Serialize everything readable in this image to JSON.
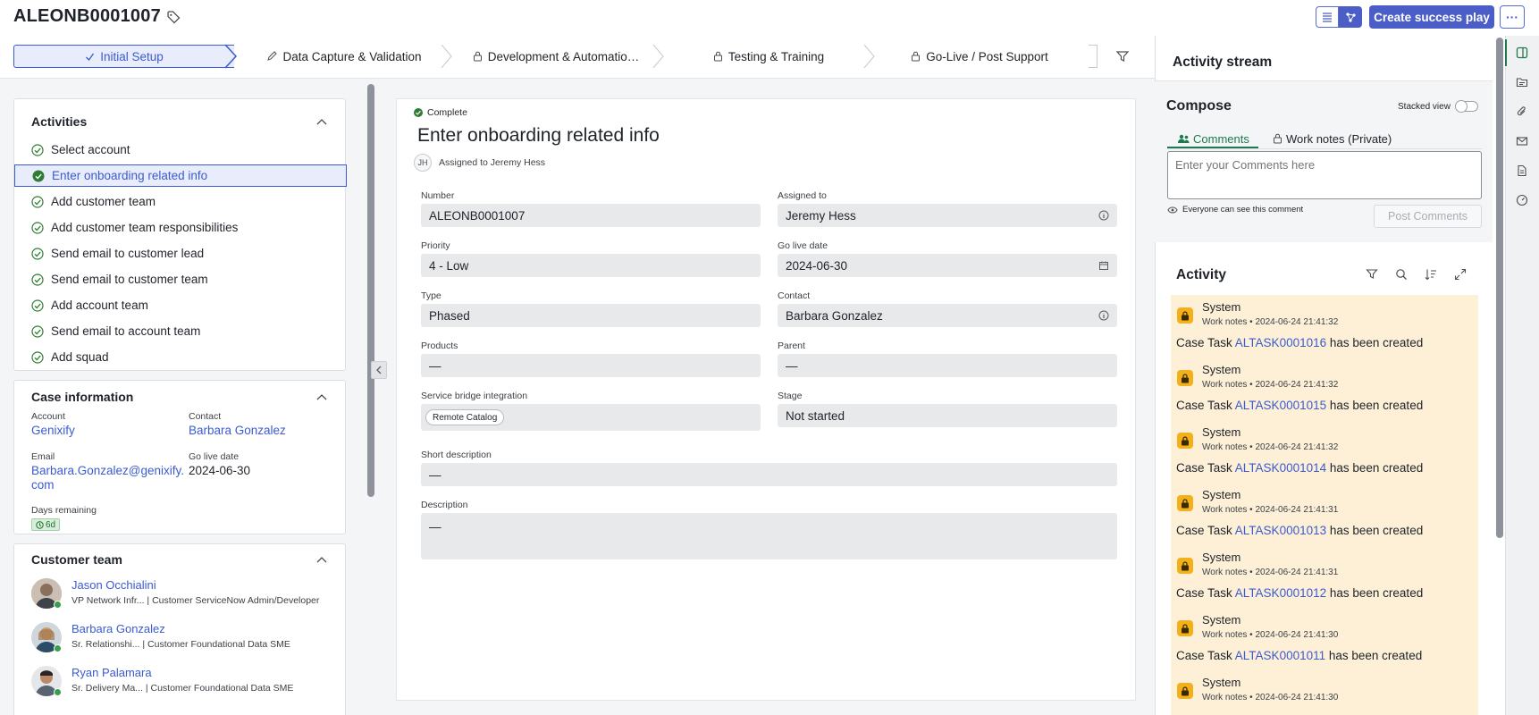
{
  "header": {
    "record_number": "ALEONB0001007",
    "create_button": "Create success play",
    "more_button": "···"
  },
  "stages": [
    {
      "label": "Initial Setup",
      "state": "complete"
    },
    {
      "label": "Data Capture & Validation",
      "state": "editable"
    },
    {
      "label": "Development & Automatio…",
      "state": "locked"
    },
    {
      "label": "Testing & Training",
      "state": "locked"
    },
    {
      "label": "Go-Live / Post Support",
      "state": "locked"
    }
  ],
  "activities": {
    "title": "Activities",
    "items": [
      "Select account",
      "Enter onboarding related info",
      "Add customer team",
      "Add customer team responsibilities",
      "Send email to customer lead",
      "Send email to customer team",
      "Add account team",
      "Send email to account team",
      "Add squad"
    ],
    "selected_index": 1
  },
  "case_info": {
    "title": "Case information",
    "account_label": "Account",
    "account_value": "Genixify",
    "contact_label": "Contact",
    "contact_value": "Barbara Gonzalez",
    "email_label": "Email",
    "email_line1": "Barbara.Gonzalez@genixify.",
    "email_line2": "com",
    "go_live_label": "Go live date",
    "go_live_value": "2024-06-30",
    "days_label": "Days remaining",
    "days_value": "6d"
  },
  "customer_team": {
    "title": "Customer team",
    "members": [
      {
        "name": "Jason Occhialini",
        "role": "VP Network Infr... | Customer ServiceNow Admin/Developer"
      },
      {
        "name": "Barbara Gonzalez",
        "role": "Sr. Relationshi... | Customer Foundational Data SME"
      },
      {
        "name": "Ryan Palamara",
        "role": "Sr. Delivery Ma... | Customer Foundational Data SME"
      }
    ]
  },
  "form": {
    "status": "Complete",
    "title": "Enter onboarding related info",
    "assignee_initials": "JH",
    "assigned_line": "Assigned to Jeremy Hess",
    "fields": {
      "number_label": "Number",
      "number_value": "ALEONB0001007",
      "assigned_label": "Assigned to",
      "assigned_value": "Jeremy Hess",
      "priority_label": "Priority",
      "priority_value": "4 - Low",
      "go_live_label": "Go live date",
      "go_live_value": "2024-06-30",
      "type_label": "Type",
      "type_value": "Phased",
      "contact_label": "Contact",
      "contact_value": "Barbara Gonzalez",
      "products_label": "Products",
      "products_value": "—",
      "parent_label": "Parent",
      "parent_value": "—",
      "sbi_label": "Service bridge integration",
      "sbi_chip": "Remote Catalog",
      "stage_label": "Stage",
      "stage_value": "Not started",
      "short_desc_label": "Short description",
      "short_desc_value": "—",
      "desc_label": "Description",
      "desc_value": "—"
    }
  },
  "stream": {
    "title": "Activity stream",
    "compose_title": "Compose",
    "stacked_label": "Stacked view",
    "tab_comments": "Comments",
    "tab_worknotes": "Work notes (Private)",
    "comment_placeholder": "Enter your Comments here",
    "visibility_note": "Everyone can see this comment",
    "post_button": "Post Comments",
    "activity_title": "Activity",
    "entries": [
      {
        "author": "System",
        "meta": "Work notes • 2024-06-24 21:41:32",
        "prefix": "Case Task ",
        "task": "ALTASK0001016",
        "suffix": " has been created"
      },
      {
        "author": "System",
        "meta": "Work notes • 2024-06-24 21:41:32",
        "prefix": "Case Task ",
        "task": "ALTASK0001015",
        "suffix": " has been created"
      },
      {
        "author": "System",
        "meta": "Work notes • 2024-06-24 21:41:32",
        "prefix": "Case Task ",
        "task": "ALTASK0001014",
        "suffix": " has been created"
      },
      {
        "author": "System",
        "meta": "Work notes • 2024-06-24 21:41:31",
        "prefix": "Case Task ",
        "task": "ALTASK0001013",
        "suffix": " has been created"
      },
      {
        "author": "System",
        "meta": "Work notes • 2024-06-24 21:41:31",
        "prefix": "Case Task ",
        "task": "ALTASK0001012",
        "suffix": " has been created"
      },
      {
        "author": "System",
        "meta": "Work notes • 2024-06-24 21:41:30",
        "prefix": "Case Task ",
        "task": "ALTASK0001011",
        "suffix": " has been created"
      },
      {
        "author": "System",
        "meta": "Work notes • 2024-06-24 21:41:30"
      }
    ]
  },
  "colors": {
    "accent": "#4b5ec8",
    "link": "#3a5bd1",
    "success": "#2e7d32",
    "activity_bg": "#fdf0d7",
    "lock_badge": "#f2b11b"
  }
}
